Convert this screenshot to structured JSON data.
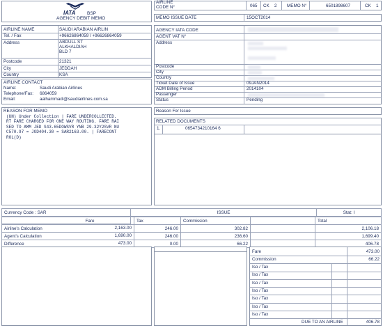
{
  "header": {
    "iata_text": "IATA",
    "bsp_text": "BSP",
    "doc_title": "AGENCY DEBIT MEMO",
    "airline_code_label": "AIRLINE CODE N°",
    "airline_code_value": "065",
    "ck1_label": "CK",
    "ck1_value": "2",
    "memo_no_label": "MEMO N°",
    "memo_no_value": "6501898607",
    "ck2_label": "CK",
    "ck2_value": "1"
  },
  "airline": {
    "name_label": "AIRLINE NAME",
    "name_value": "SAUDI ARABIAN AIRLIN",
    "tel_label": "Tel. / Fax",
    "tel_value": "+96626864059 / +96626864059",
    "address_label": "Address",
    "address_lines": [
      "ABDULL ST",
      "ALKHALDIAH",
      "BLD 7"
    ],
    "postcode_label": "Postcode",
    "postcode_value": "21321",
    "city_label": "City",
    "city_value": "JEDDAH",
    "country_label": "Country",
    "country_value": "KSA"
  },
  "contact": {
    "title": "AIRLINE CONTACT",
    "name_label": "Name:",
    "name_value": "Saudi Arabian Airlines",
    "tel_label": "Telephone/Fax:",
    "tel_value": "6864059",
    "email_label": "Email:",
    "email_value": "aalhammadi@saudiairlines.com.sa"
  },
  "memo": {
    "issue_date_label": "MEMO ISSUE DATE",
    "issue_date_value": "15OCT2014"
  },
  "agency": {
    "iata_code_label": "AGENCY IATA CODE",
    "vat_label": "AGENT VAT N°",
    "address_label": "Address",
    "postcode_label": "Postcode",
    "city_label": "City",
    "country_label": "Country",
    "ticket_date_label": "Ticket Date of Issue",
    "ticket_date_value": "09JAN2014",
    "billing_label": "ADM Billing Period",
    "billing_value": "2014104",
    "passenger_label": "Passenger",
    "status_label": "Status",
    "status_value": "Pending"
  },
  "reason_memo": {
    "title": "REASON FOR MEMO",
    "lines": [
      "(UN) Under Collection | FARE UNDERCOLLECTED.",
      "RT FARE CHARGED FOR ONE WAY ROUTING. FARE RAI",
      "SED TO AMM JED S43.65DOWSVR YNB 29.32Y2SVR NU",
      "C570.97 = JOD404.30 = SAR2163.00. | FARECONT",
      "ROL(D)"
    ]
  },
  "reason_issue": {
    "title": "Reason For Issue"
  },
  "related_docs": {
    "title": "RELATED DOCUMENTS",
    "items": [
      {
        "num": "1.",
        "value": "0654734210164 6"
      }
    ]
  },
  "calc": {
    "currency_label": "Currency Code : SAR",
    "issue_label": "ISSUE",
    "stat_label": "Stat: I",
    "col_fare": "Fare",
    "col_tax": "Tax",
    "col_commission": "Commission",
    "col_total": "Total",
    "rows": [
      {
        "label": "Airline's Calculation",
        "fare": "2,163.00",
        "tax": "246.00",
        "commission": "302.82",
        "total": "2,106.18"
      },
      {
        "label": "Agent's Calculation",
        "fare": "1,690.00",
        "tax": "246.00",
        "commission": "236.60",
        "total": "1,699.40"
      },
      {
        "label": "Difference",
        "fare": "473.00",
        "tax": "0.00",
        "commission": "66.22",
        "total": "406.78"
      }
    ]
  },
  "summary": {
    "fare_label": "Fare",
    "fare_value": "473.00",
    "commission_label": "Commission",
    "commission_value": "66.22",
    "iso_tax_label": "Iso / Tax",
    "iso_tax_count": 7,
    "due_label": "DUE TO AN AIRLINE",
    "due_value": "406.78"
  },
  "colors": {
    "text": "#1a2a5a",
    "border": "#8a94a8",
    "header_fill": "#d9deea"
  }
}
